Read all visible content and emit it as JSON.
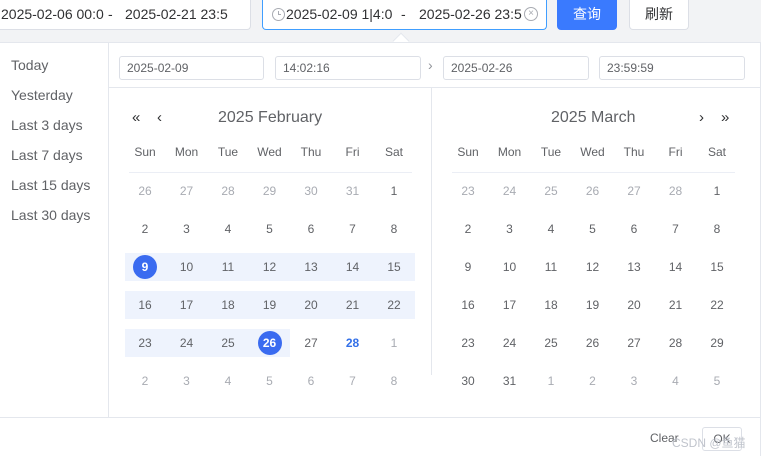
{
  "toolbar": {
    "range1_start": "2025-02-06 00:0",
    "range1_sep": "-",
    "range1_end": "2025-02-21 23:5",
    "range2_start": "2025-02-09 1|4:0",
    "range2_sep": "-",
    "range2_end": "2025-02-26 23:5",
    "query_label": "查询",
    "refresh_label": "刷新"
  },
  "shortcuts": [
    "Today",
    "Yesterday",
    "Last 3 days",
    "Last 7 days",
    "Last 15 days",
    "Last 30 days"
  ],
  "header": {
    "start_date": "2025-02-09",
    "start_time": "14:02:16",
    "end_date": "2025-02-26",
    "end_time": "23:59:59",
    "separator": "›"
  },
  "weekdays": [
    "Sun",
    "Mon",
    "Tue",
    "Wed",
    "Thu",
    "Fri",
    "Sat"
  ],
  "left_month": {
    "title": "2025 February",
    "weeks": [
      [
        "26",
        "27",
        "28",
        "29",
        "30",
        "31",
        "1"
      ],
      [
        "2",
        "3",
        "4",
        "5",
        "6",
        "7",
        "8"
      ],
      [
        "9",
        "10",
        "11",
        "12",
        "13",
        "14",
        "15"
      ],
      [
        "16",
        "17",
        "18",
        "19",
        "20",
        "21",
        "22"
      ],
      [
        "23",
        "24",
        "25",
        "26",
        "27",
        "28",
        "1"
      ],
      [
        "2",
        "3",
        "4",
        "5",
        "6",
        "7",
        "8"
      ]
    ]
  },
  "right_month": {
    "title": "2025 March",
    "weeks": [
      [
        "23",
        "24",
        "25",
        "26",
        "27",
        "28",
        "1"
      ],
      [
        "2",
        "3",
        "4",
        "5",
        "6",
        "7",
        "8"
      ],
      [
        "9",
        "10",
        "11",
        "12",
        "13",
        "14",
        "15"
      ],
      [
        "16",
        "17",
        "18",
        "19",
        "20",
        "21",
        "22"
      ],
      [
        "23",
        "24",
        "25",
        "26",
        "27",
        "28",
        "29"
      ],
      [
        "30",
        "31",
        "1",
        "2",
        "3",
        "4",
        "5"
      ]
    ]
  },
  "nav": {
    "prev_year": "«",
    "prev_month": "‹",
    "next_month": "›",
    "next_year": "»"
  },
  "footer": {
    "clear_label": "Clear",
    "ok_label": "OK"
  },
  "watermark": "CSDN @鱼猫",
  "colors": {
    "accent": "#3a6bf0",
    "range_bg": "#eef3fd",
    "today": "#3370e8"
  }
}
